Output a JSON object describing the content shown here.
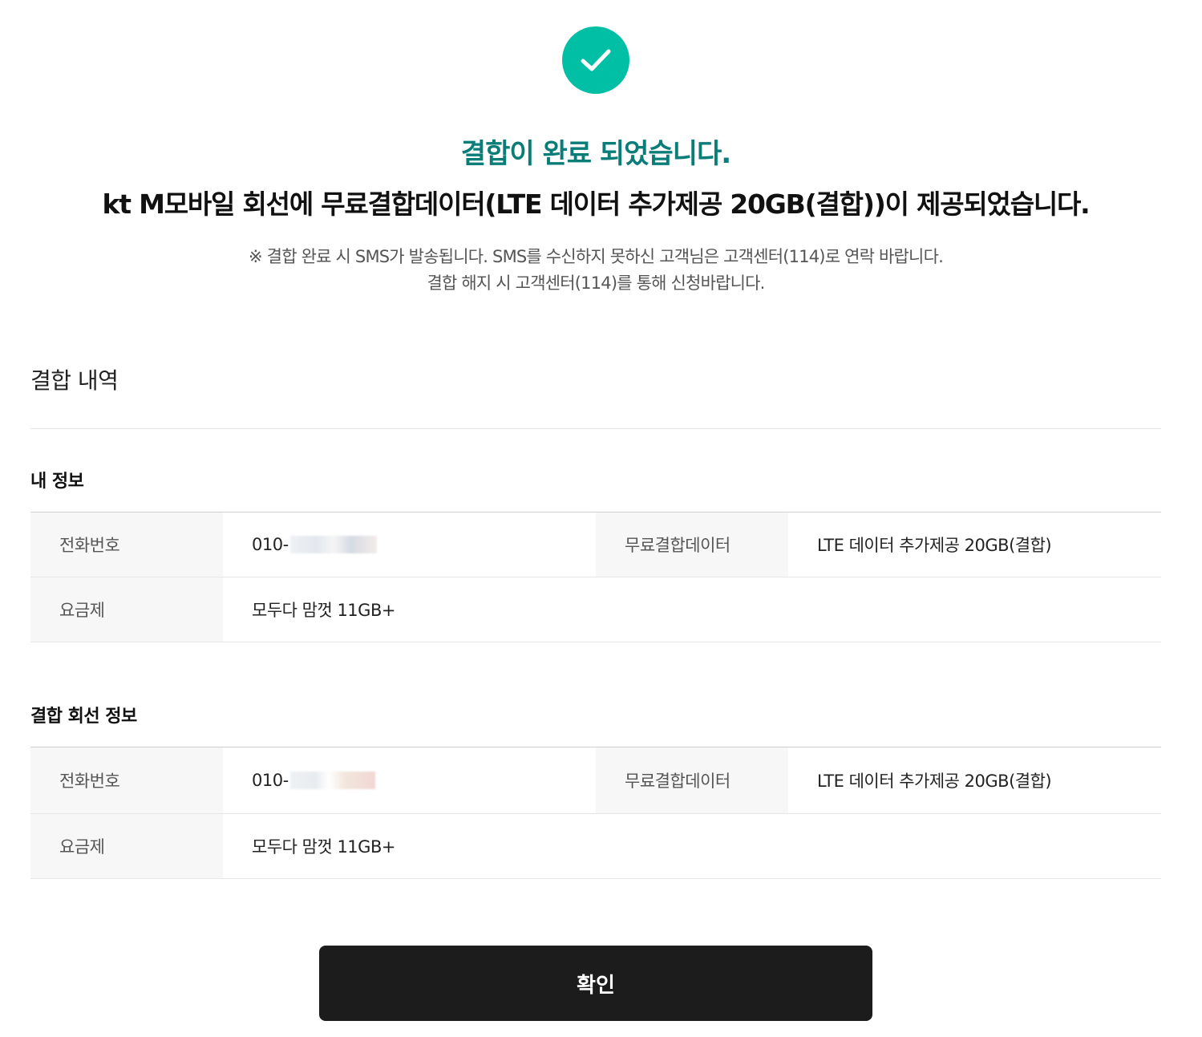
{
  "status": {
    "icon": "check-icon",
    "accent_color": "#00bfa5",
    "headline": "결합이 완료 되었습니다.",
    "message": "kt M모바일 회선에 무료결합데이터(LTE 데이터 추가제공 20GB(결합))이 제공되었습니다.",
    "notice_line1": "※ 결합 완료 시 SMS가 발송됩니다. SMS를 수신하지 못하신 고객님은 고객센터(114)로 연락 바랍니다.",
    "notice_line2": "결합 해지 시 고객센터(114)를 통해 신청바랍니다."
  },
  "details": {
    "title": "결합 내역",
    "my_info": {
      "title": "내 정보",
      "phone_label": "전화번호",
      "phone_value": "010-",
      "free_data_label": "무료결합데이터",
      "free_data_value": "LTE 데이터 추가제공 20GB(결합)",
      "plan_label": "요금제",
      "plan_value": "모두다 맘껏 11GB+"
    },
    "linked_line": {
      "title": "결합 회선 정보",
      "phone_label": "전화번호",
      "phone_value": "010-",
      "free_data_label": "무료결합데이터",
      "free_data_value": "LTE 데이터 추가제공 20GB(결합)",
      "plan_label": "요금제",
      "plan_value": "모두다 맘껏 11GB+"
    }
  },
  "actions": {
    "confirm_label": "확인"
  }
}
